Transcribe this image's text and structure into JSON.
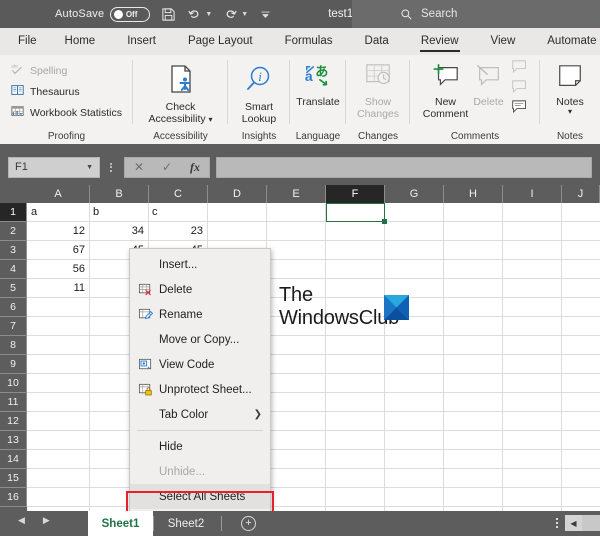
{
  "titlebar": {
    "autosave_label": "AutoSave",
    "autosave_state": "Off",
    "save_icon": "save-icon",
    "undo_icon": "undo-icon",
    "redo_icon": "redo-icon",
    "customize_icon": "customize-quick-access-icon",
    "document_name": "test1",
    "search_icon": "search-icon",
    "search_placeholder": "Search"
  },
  "ribbon_tabs": [
    {
      "label": "File",
      "active": false
    },
    {
      "label": "Home",
      "active": false
    },
    {
      "label": "Insert",
      "active": false
    },
    {
      "label": "Page Layout",
      "active": false
    },
    {
      "label": "Formulas",
      "active": false
    },
    {
      "label": "Data",
      "active": false
    },
    {
      "label": "Review",
      "active": true
    },
    {
      "label": "View",
      "active": false
    },
    {
      "label": "Automate",
      "active": false
    }
  ],
  "ribbon_groups": [
    {
      "name": "Proofing",
      "label": "Proofing",
      "items": [
        {
          "label": "Spelling",
          "icon": "spelling-abc-check-icon",
          "disabled": true
        },
        {
          "label": "Thesaurus",
          "icon": "thesaurus-book-icon",
          "disabled": false
        },
        {
          "label": "Workbook Statistics",
          "icon": "workbook-statistics-icon",
          "disabled": false
        }
      ]
    },
    {
      "name": "Accessibility",
      "label": "Accessibility",
      "items": [
        {
          "label": "Check\nAccessibility",
          "label_line1": "Check",
          "label_line2": "Accessibility",
          "icon": "check-accessibility-icon",
          "has_caret": true,
          "disabled": false
        }
      ]
    },
    {
      "name": "Insights",
      "label": "Insights",
      "items": [
        {
          "label_line1": "Smart",
          "label_line2": "Lookup",
          "icon": "smart-lookup-icon",
          "disabled": false
        }
      ]
    },
    {
      "name": "Language",
      "label": "Language",
      "items": [
        {
          "label_line1": "Translate",
          "label_line2": "",
          "icon": "translate-icon",
          "disabled": false
        }
      ]
    },
    {
      "name": "Changes",
      "label": "Changes",
      "items": [
        {
          "label_line1": "Show",
          "label_line2": "Changes",
          "icon": "show-changes-icon",
          "disabled": true
        }
      ]
    },
    {
      "name": "Comments",
      "label": "Comments",
      "items": [
        {
          "label_line1": "New",
          "label_line2": "Comment",
          "icon": "new-comment-icon",
          "disabled": false
        },
        {
          "label_line1": "Delete",
          "label_line2": "",
          "icon": "delete-comment-icon",
          "disabled": true
        },
        {
          "label_line1": "",
          "label_line2": "",
          "icon": "previous-comment-icon",
          "disabled": true
        },
        {
          "label_line1": "",
          "label_line2": "",
          "icon": "next-comment-icon",
          "disabled": true
        },
        {
          "label_line1": "",
          "label_line2": "",
          "icon": "show-comments-icon",
          "disabled": false
        }
      ]
    },
    {
      "name": "Notes",
      "label": "Notes",
      "items": [
        {
          "label_line1": "Notes",
          "label_line2": "",
          "icon": "notes-icon",
          "has_caret": true,
          "disabled": false
        }
      ]
    }
  ],
  "formula_bar": {
    "name_box_value": "F1",
    "name_box_caret_icon": "chevron-down-icon",
    "cancel_icon": "cancel-x-icon",
    "confirm_icon": "confirm-check-icon",
    "function_icon": "insert-function-fx-icon",
    "formula_value": ""
  },
  "grid": {
    "columns": [
      "A",
      "B",
      "C",
      "D",
      "E",
      "F",
      "G",
      "H",
      "I",
      "J"
    ],
    "selected_column": "F",
    "rows": [
      "1",
      "2",
      "3",
      "4",
      "5",
      "6",
      "7",
      "8",
      "9",
      "10",
      "11",
      "12",
      "13",
      "14",
      "15",
      "16"
    ],
    "selected_row": "1",
    "selected_cell": "F1",
    "cells": [
      {
        "col": "A",
        "row": "1",
        "value": "a",
        "align": "left"
      },
      {
        "col": "B",
        "row": "1",
        "value": "b",
        "align": "left"
      },
      {
        "col": "C",
        "row": "1",
        "value": "c",
        "align": "left"
      },
      {
        "col": "A",
        "row": "2",
        "value": "12",
        "align": "right"
      },
      {
        "col": "B",
        "row": "2",
        "value": "34",
        "align": "right"
      },
      {
        "col": "C",
        "row": "2",
        "value": "23",
        "align": "right"
      },
      {
        "col": "A",
        "row": "3",
        "value": "67",
        "align": "right"
      },
      {
        "col": "B",
        "row": "3",
        "value": "45",
        "align": "right"
      },
      {
        "col": "C",
        "row": "3",
        "value": "45",
        "align": "right"
      },
      {
        "col": "A",
        "row": "4",
        "value": "56",
        "align": "right"
      },
      {
        "col": "A",
        "row": "5",
        "value": "11",
        "align": "right"
      }
    ],
    "watermark": {
      "line1": "The",
      "line2": "WindowsClub",
      "logo_icon": "windowsclub-logo-icon"
    }
  },
  "context_menu": {
    "items": [
      {
        "label": "Insert...",
        "accel": "I",
        "icon": null,
        "disabled": false,
        "submenu": false,
        "separator_after": false
      },
      {
        "label": "Delete",
        "accel": "D",
        "icon": "delete-sheet-icon",
        "disabled": false,
        "submenu": false,
        "separator_after": false
      },
      {
        "label": "Rename",
        "accel": "R",
        "icon": "rename-sheet-icon",
        "disabled": false,
        "submenu": false,
        "separator_after": false
      },
      {
        "label": "Move or Copy...",
        "accel": "M",
        "icon": null,
        "disabled": false,
        "submenu": false,
        "separator_after": false
      },
      {
        "label": "View Code",
        "accel": "V",
        "icon": "view-code-icon",
        "disabled": false,
        "submenu": false,
        "separator_after": false
      },
      {
        "label": "Unprotect Sheet...",
        "accel": "P",
        "icon": "unprotect-sheet-icon",
        "disabled": false,
        "submenu": false,
        "separator_after": false
      },
      {
        "label": "Tab Color",
        "accel": "T",
        "icon": null,
        "disabled": false,
        "submenu": true,
        "separator_after": true
      },
      {
        "label": "Hide",
        "accel": "H",
        "icon": null,
        "disabled": false,
        "submenu": false,
        "separator_after": false
      },
      {
        "label": "Unhide...",
        "accel": "U",
        "icon": null,
        "disabled": true,
        "submenu": false,
        "separator_after": false
      },
      {
        "label": "Select All Sheets",
        "accel": "S",
        "icon": null,
        "disabled": false,
        "submenu": false,
        "separator_after": false,
        "highlighted": true
      }
    ],
    "highlight_color": "#e8202a"
  },
  "sheet_tabs": {
    "prev_icon": "nav-previous-icon",
    "next_icon": "nav-next-icon",
    "tabs": [
      {
        "label": "Sheet1",
        "active": true
      },
      {
        "label": "Sheet2",
        "active": false
      }
    ],
    "add_sheet_icon": "add-sheet-plus-icon",
    "more_icon": "more-options-icon",
    "hscroll_left_icon": "scroll-left-icon"
  },
  "colors": {
    "excel_green": "#217346",
    "chrome_gray": "#5d5d5d",
    "ribbon_bg": "#f3f2f1",
    "tabbar_bg": "#e9e8e6",
    "highlight_red": "#e8202a"
  }
}
